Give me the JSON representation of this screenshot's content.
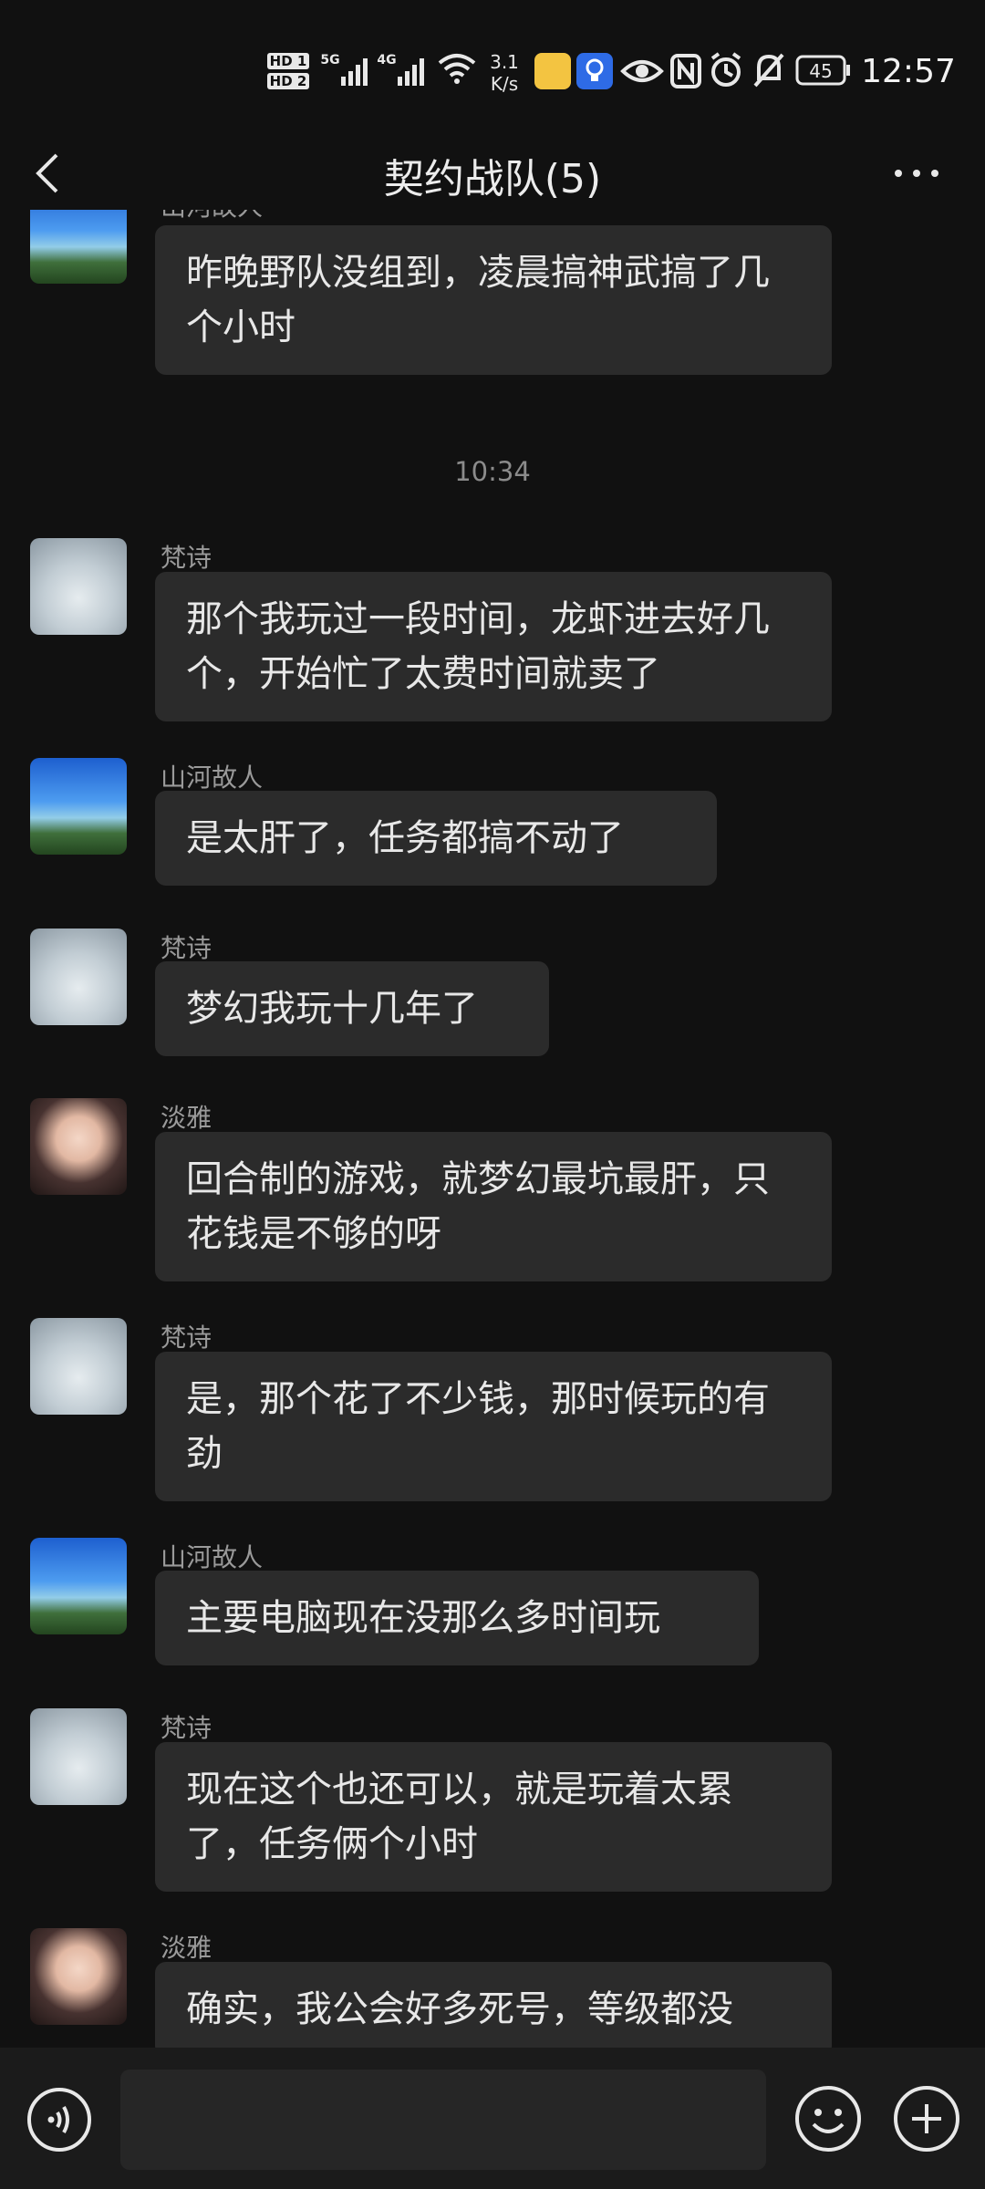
{
  "status_bar": {
    "sim1": "HD 1",
    "sim2": "HD 2",
    "network1": "5G",
    "network2": "4G",
    "speed_value": "3.1",
    "speed_unit": "K/s",
    "battery": "45",
    "time": "12:57"
  },
  "header": {
    "title": "契约战队(5)"
  },
  "messages": [
    {
      "sender": "山河故人",
      "text": "昨晚野队没组到，凌晨搞神武搞了几个小时"
    },
    {
      "time": "10:34"
    },
    {
      "sender": "梵诗",
      "text": "那个我玩过一段时间，龙虾进去好几个，开始忙了太费时间就卖了"
    },
    {
      "sender": "山河故人",
      "text": "是太肝了，任务都搞不动了"
    },
    {
      "sender": "梵诗",
      "text": "梦幻我玩十几年了"
    },
    {
      "sender": "淡雅",
      "text": "回合制的游戏，就梦幻最坑最肝，只花钱是不够的呀"
    },
    {
      "sender": "梵诗",
      "text": "是，那个花了不少钱，那时候玩的有劲"
    },
    {
      "sender": "山河故人",
      "text": "主要电脑现在没那么多时间玩"
    },
    {
      "sender": "梵诗",
      "text": "现在这个也还可以，就是玩着太累了，任务俩个小时"
    },
    {
      "sender": "淡雅",
      "text": "确实，我公会好多死号，等级都没"
    }
  ],
  "colors": {
    "background": "#111111",
    "bubble": "#2b2b2b",
    "input_bar": "#1b1b1b",
    "text": "#e8e8e8",
    "secondary_text": "#9a9a9a"
  },
  "icons": {
    "back": "chevron-left-icon",
    "more": "more-dots-icon",
    "voice": "voice-icon",
    "emoji": "emoji-icon",
    "plus": "plus-icon"
  }
}
